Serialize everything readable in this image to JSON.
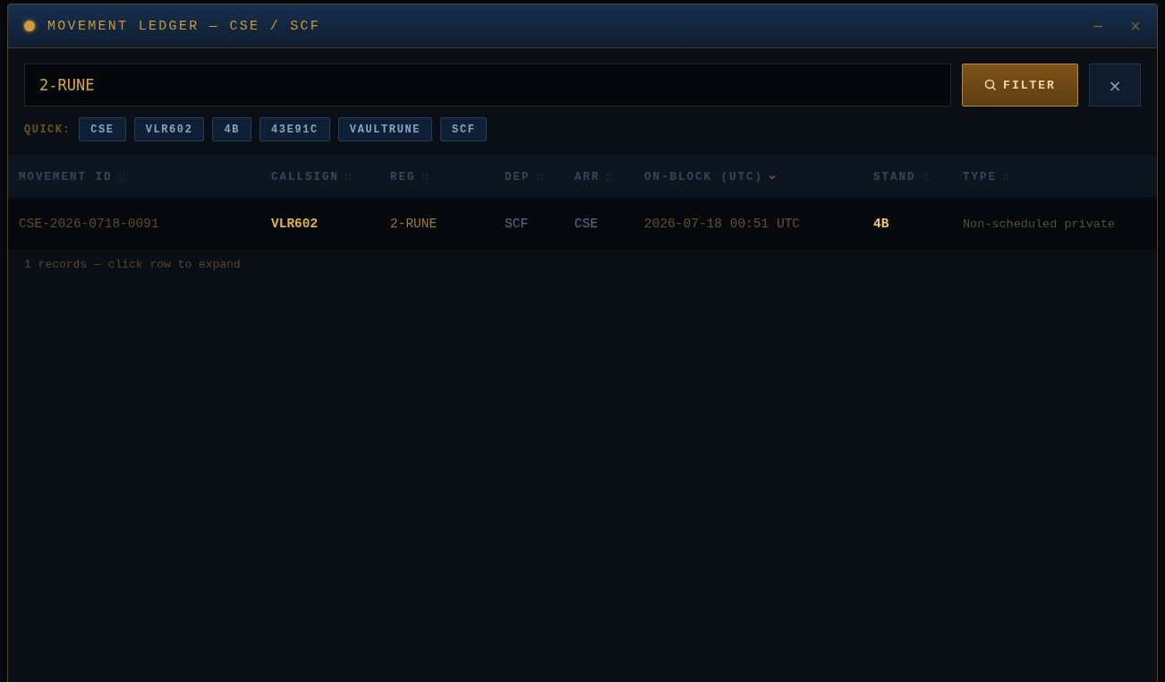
{
  "window": {
    "title": "MOVEMENT LEDGER — CSE / SCF",
    "status_dot": true
  },
  "search": {
    "value": "2-RUNE",
    "filter_button": "FILTER",
    "clear_button": "×"
  },
  "quick": {
    "label": "QUICK:",
    "chips": [
      "CSE",
      "VLR602",
      "4B",
      "43E91C",
      "VAULTRUNE",
      "SCF"
    ]
  },
  "table": {
    "columns": [
      {
        "label": "MOVEMENT ID",
        "sorted": false
      },
      {
        "label": "CALLSIGN",
        "sorted": false
      },
      {
        "label": "REG",
        "sorted": false
      },
      {
        "label": "DEP",
        "sorted": false
      },
      {
        "label": "ARR",
        "sorted": false
      },
      {
        "label": "ON-BLOCK (UTC)",
        "sorted": true
      },
      {
        "label": "STAND",
        "sorted": false
      },
      {
        "label": "TYPE",
        "sorted": false
      }
    ],
    "rows": [
      [
        "CSE-2026-0718-0091",
        "VLR602",
        "2-RUNE",
        "SCF",
        "CSE",
        "2026-07-18 00:51 UTC",
        "4B",
        "Non-scheduled private"
      ]
    ]
  },
  "footer": "1 records — click row to expand"
}
